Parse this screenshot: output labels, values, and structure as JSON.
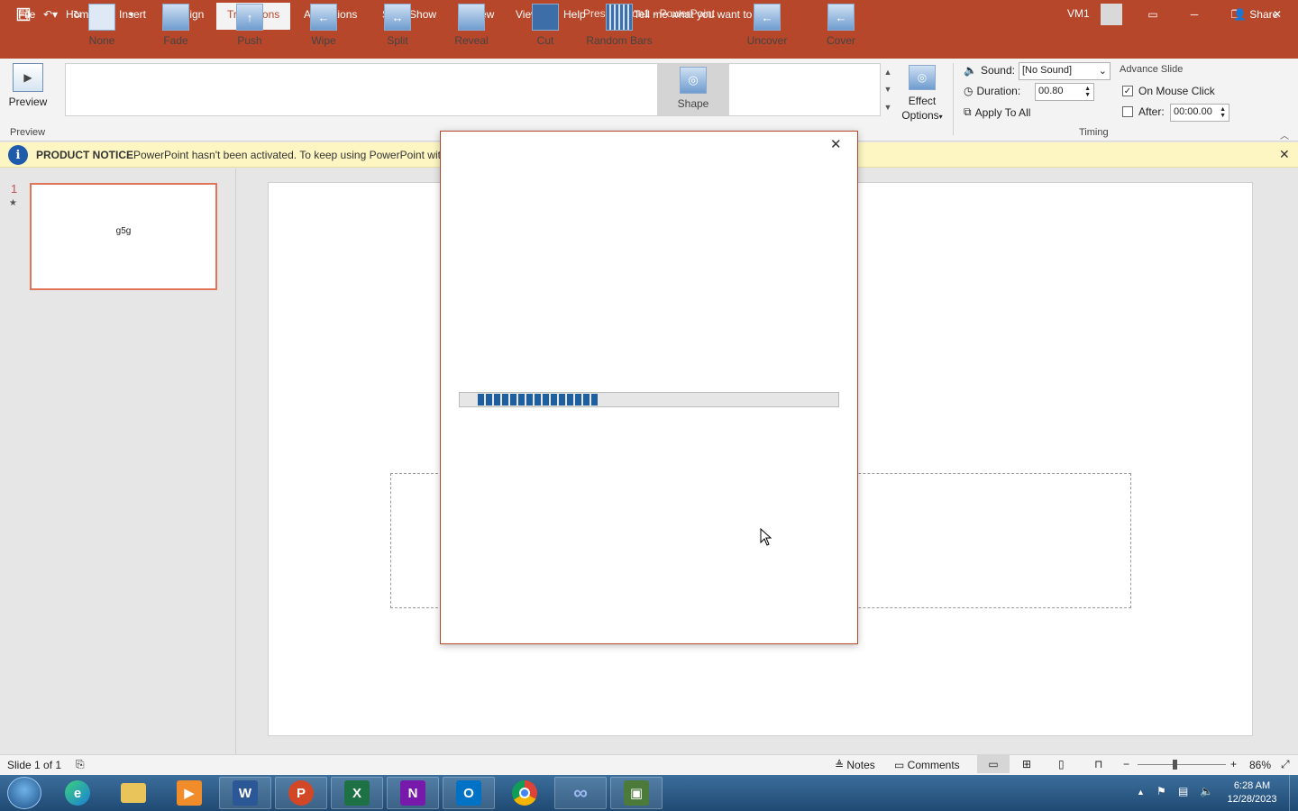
{
  "window": {
    "title": "Presentation1  -  PowerPoint",
    "user": "VM1"
  },
  "tabs": [
    "File",
    "Home",
    "Insert",
    "Design",
    "Transitions",
    "Animations",
    "Slide Show",
    "Review",
    "View",
    "Help"
  ],
  "active_tab": "Transitions",
  "tell_me": "Tell me what you want to do",
  "share": "Share",
  "ribbon": {
    "preview_label": "Preview",
    "preview_group": "Preview",
    "transitions": [
      "None",
      "Fade",
      "Push",
      "Wipe",
      "Split",
      "Reveal",
      "Cut",
      "Random Bars",
      "Shape",
      "Uncover",
      "Cover"
    ],
    "selected_transition": "Shape",
    "effect_options": "Effect",
    "effect_options2": "Options",
    "sound_label": "Sound:",
    "sound_value": "[No Sound]",
    "duration_label": "Duration:",
    "duration_value": "00.80",
    "apply_all": "Apply To All",
    "advance_label": "Advance Slide",
    "on_mouse_click": "On Mouse Click",
    "after_label": "After:",
    "after_value": "00:00.00",
    "timing_group": "Timing"
  },
  "notice": {
    "title": "PRODUCT NOTICE",
    "text": "PowerPoint hasn't been activated. To keep using PowerPoint wit"
  },
  "thumbnail": {
    "number": "1",
    "star": "★",
    "text": "g5g"
  },
  "dialog": {
    "progress": 0.32
  },
  "status": {
    "slide": "Slide 1 of 1",
    "notes": "Notes",
    "comments": "Comments",
    "zoom": "86%"
  },
  "taskbar": {
    "time": "6:28 AM",
    "date": "12/28/2023"
  },
  "colors": {
    "accent": "#b7472a",
    "progress": "#1e5f9f"
  }
}
